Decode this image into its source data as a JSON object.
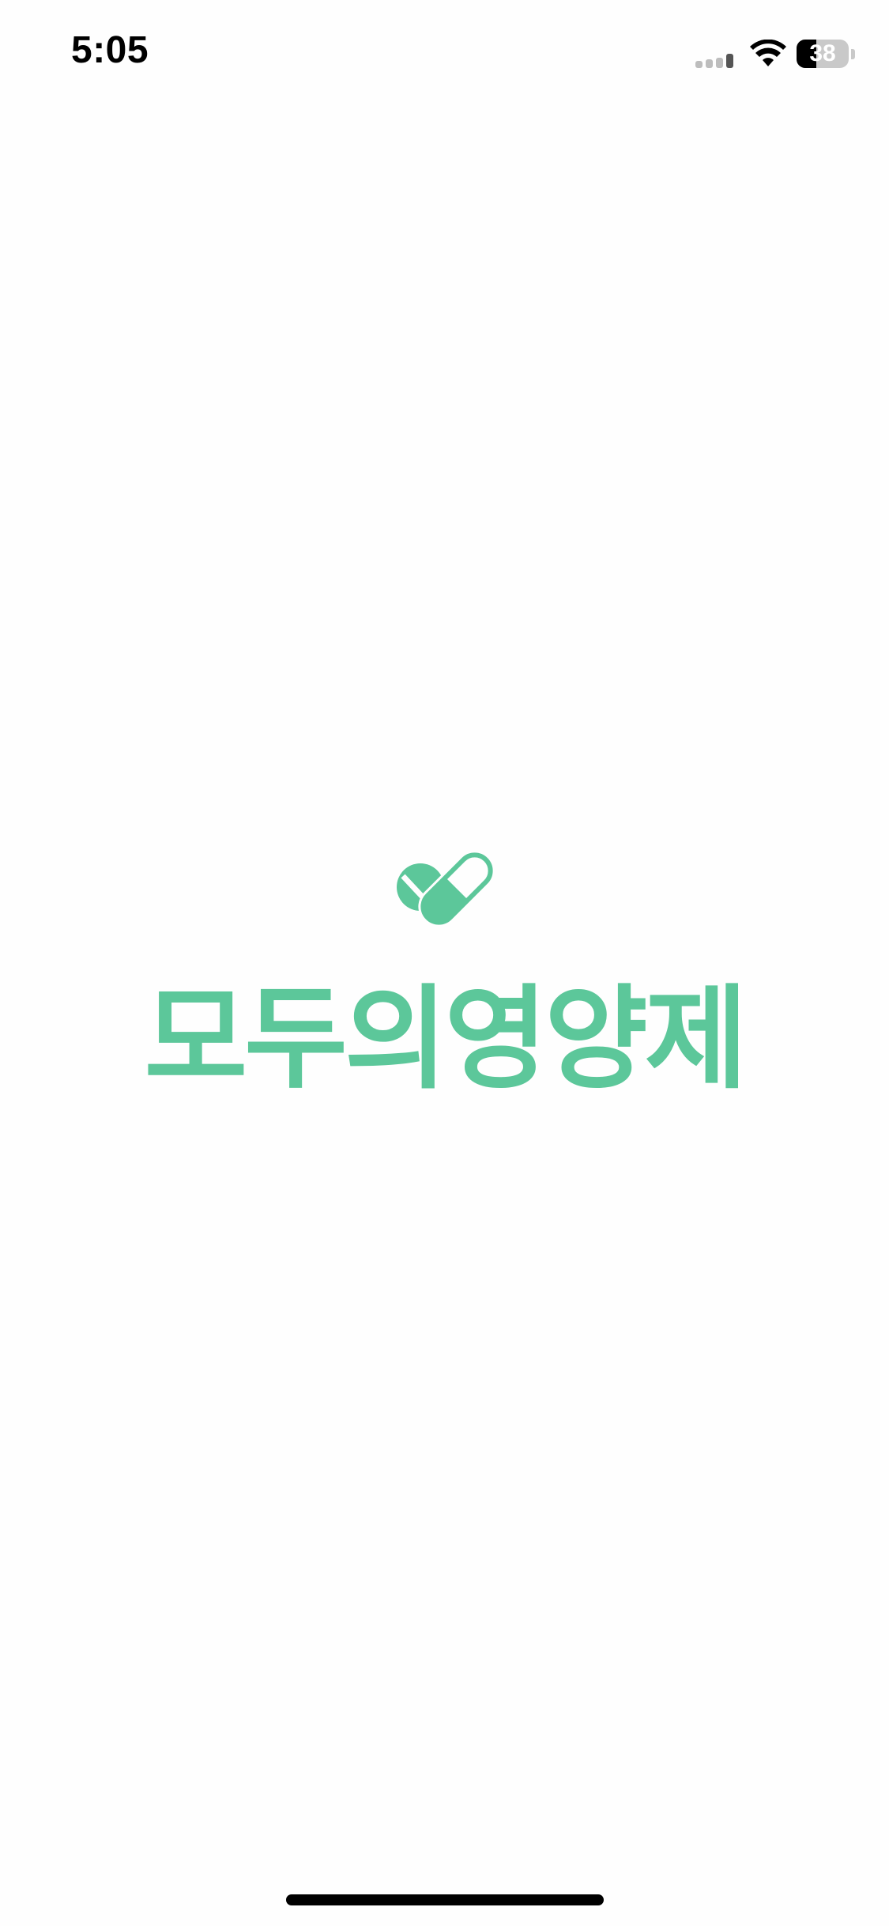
{
  "status_bar": {
    "time": "5:05",
    "battery_level": "38",
    "signal_bars_active": 1,
    "signal_bars_total": 4,
    "icons": [
      "cellular-signal-icon",
      "wifi-icon",
      "battery-icon"
    ]
  },
  "splash": {
    "app_name": "모두의영양제",
    "logo_icon": "pill-capsule-icon"
  },
  "colors": {
    "brand": "#5cc79a",
    "brand_light": "#7fd9b3",
    "background": "#fefefe",
    "text_dark": "#000000"
  }
}
